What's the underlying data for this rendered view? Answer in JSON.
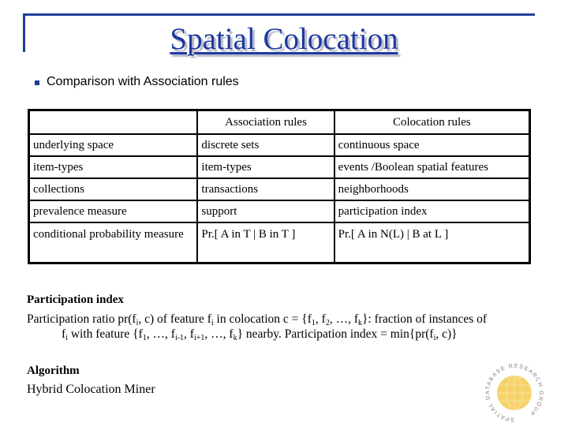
{
  "slide": {
    "title": "Spatial Colocation",
    "bullet": "Comparison with Association rules"
  },
  "table": {
    "headers": [
      "",
      "Association rules",
      "Colocation rules"
    ],
    "rows": [
      [
        "underlying space",
        "discrete sets",
        "continuous space"
      ],
      [
        "item-types",
        "item-types",
        "events /Boolean spatial features"
      ],
      [
        "collections",
        "transactions",
        "neighborhoods"
      ],
      [
        "prevalence measure",
        "support",
        "participation index"
      ],
      [
        "conditional probability measure",
        "Pr.[ A in T | B in T ]",
        "Pr.[ A in N(L) | B at L ]"
      ]
    ]
  },
  "participation": {
    "heading": "Participation index",
    "line1_a": "Participation ratio pr(f",
    "line1_sub_i": "i",
    "line1_b": ", c) of feature f",
    "line1_c": " in colocation c = {f",
    "line1_sub_1": "1",
    "line1_d": ", f",
    "line1_sub_2": "2",
    "line1_e": ", …, f",
    "line1_sub_k": "k",
    "line1_f": "}: fraction of instances of",
    "line2_a": "f",
    "line2_b": " with feature {f",
    "line2_c": ", …, f",
    "line2_sub_im1": "i-1",
    "line2_d": ",  f",
    "line2_sub_ip1": "i+1",
    "line2_e": ", …, f",
    "line2_f": "} nearby. Participation index = min{pr(f",
    "line2_g": ", c)}"
  },
  "algorithm": {
    "heading": "Algorithm",
    "name": "Hybrid Colocation Miner"
  },
  "logo": {
    "text": "SPATIAL DATABASE RESEARCH GROUP",
    "globe_color": "#f6d36a"
  },
  "colors": {
    "accent": "#1f3a9e"
  }
}
